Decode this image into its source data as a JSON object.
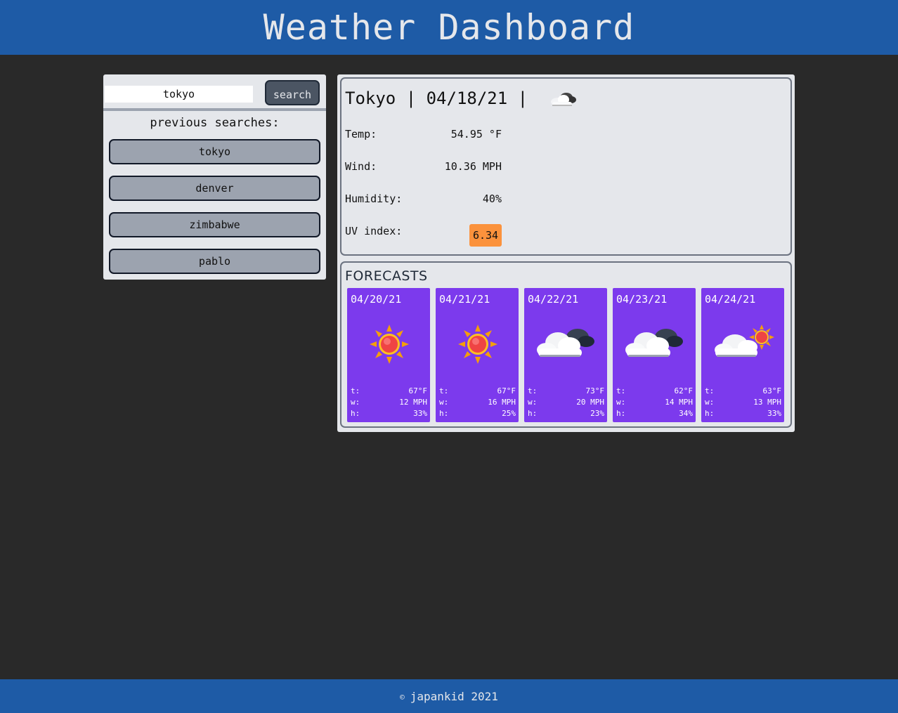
{
  "header": {
    "title": "Weather Dashboard"
  },
  "search": {
    "value": "tokyo",
    "button_label": "search"
  },
  "history": {
    "title": "previous searches:",
    "items": [
      "tokyo",
      "denver",
      "zimbabwe",
      "pablo"
    ]
  },
  "current": {
    "title": "Tokyo | 04/18/21 | ",
    "icon": "cloud-dark-icon",
    "temp_label": "Temp:",
    "temp_value": "54.95 °F",
    "wind_label": "Wind:",
    "wind_value": "10.36 MPH",
    "humidity_label": "Humidity:",
    "humidity_value": "40%",
    "uv_label": "UV index:",
    "uv_value": "6.34",
    "uv_color": "#fb923c"
  },
  "forecast": {
    "title": "FORECASTS",
    "card_color": "#7c3aed",
    "days": [
      {
        "date": "04/20/21",
        "icon": "sun-icon",
        "t_label": "t:",
        "t": "67°F",
        "w_label": "w:",
        "w": "12 MPH",
        "h_label": "h:",
        "h": "33%"
      },
      {
        "date": "04/21/21",
        "icon": "sun-icon",
        "t_label": "t:",
        "t": "67°F",
        "w_label": "w:",
        "w": "16 MPH",
        "h_label": "h:",
        "h": "25%"
      },
      {
        "date": "04/22/21",
        "icon": "clouds-icon",
        "t_label": "t:",
        "t": "73°F",
        "w_label": "w:",
        "w": "20 MPH",
        "h_label": "h:",
        "h": "23%"
      },
      {
        "date": "04/23/21",
        "icon": "clouds-icon",
        "t_label": "t:",
        "t": "62°F",
        "w_label": "w:",
        "w": "14 MPH",
        "h_label": "h:",
        "h": "34%"
      },
      {
        "date": "04/24/21",
        "icon": "partly-cloudy-icon",
        "t_label": "t:",
        "t": "63°F",
        "w_label": "w:",
        "w": "13 MPH",
        "h_label": "h:",
        "h": "33%"
      }
    ]
  },
  "footer": {
    "copyright_symbol": "©",
    "text": "japankid 2021"
  }
}
